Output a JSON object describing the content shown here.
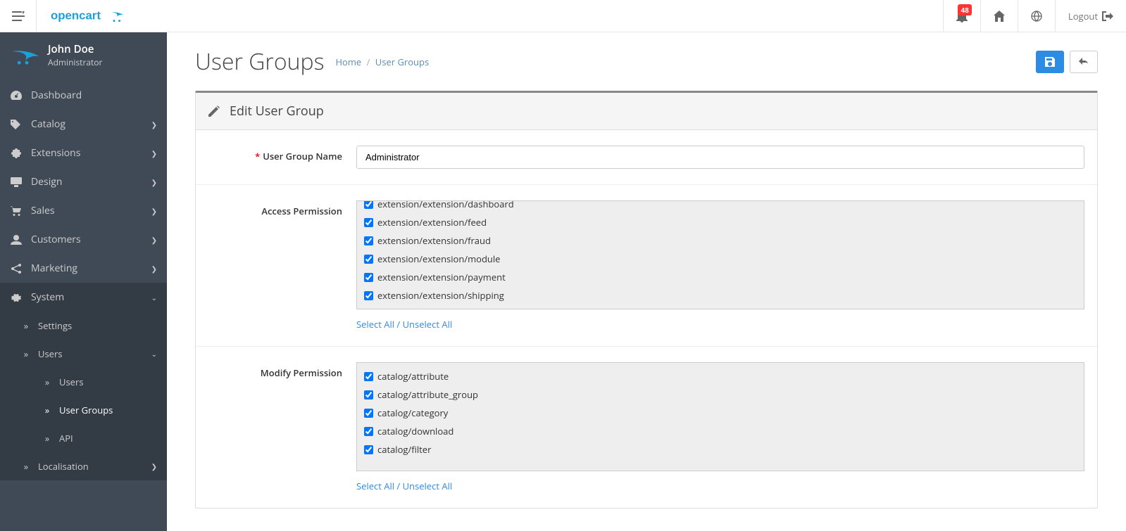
{
  "header": {
    "notification_count": "48",
    "logout_label": "Logout"
  },
  "profile": {
    "name": "John Doe",
    "role": "Administrator"
  },
  "sidebar": {
    "dashboard": "Dashboard",
    "catalog": "Catalog",
    "extensions": "Extensions",
    "design": "Design",
    "sales": "Sales",
    "customers": "Customers",
    "marketing": "Marketing",
    "system": "System",
    "settings": "Settings",
    "users": "Users",
    "users_sub": "Users",
    "user_groups": "User Groups",
    "api": "API",
    "localisation": "Localisation"
  },
  "page": {
    "title": "User Groups",
    "breadcrumb_home": "Home",
    "breadcrumb_current": "User Groups",
    "panel_title": "Edit User Group"
  },
  "form": {
    "name_label": "User Group Name",
    "name_value": "Administrator",
    "access_label": "Access Permission",
    "modify_label": "Modify Permission",
    "select_all": "Select All",
    "unselect_all": "Unselect All",
    "access_items": [
      "extension/extension/dashboard",
      "extension/extension/feed",
      "extension/extension/fraud",
      "extension/extension/module",
      "extension/extension/payment",
      "extension/extension/shipping"
    ],
    "modify_items": [
      "catalog/attribute",
      "catalog/attribute_group",
      "catalog/category",
      "catalog/download",
      "catalog/filter"
    ]
  }
}
